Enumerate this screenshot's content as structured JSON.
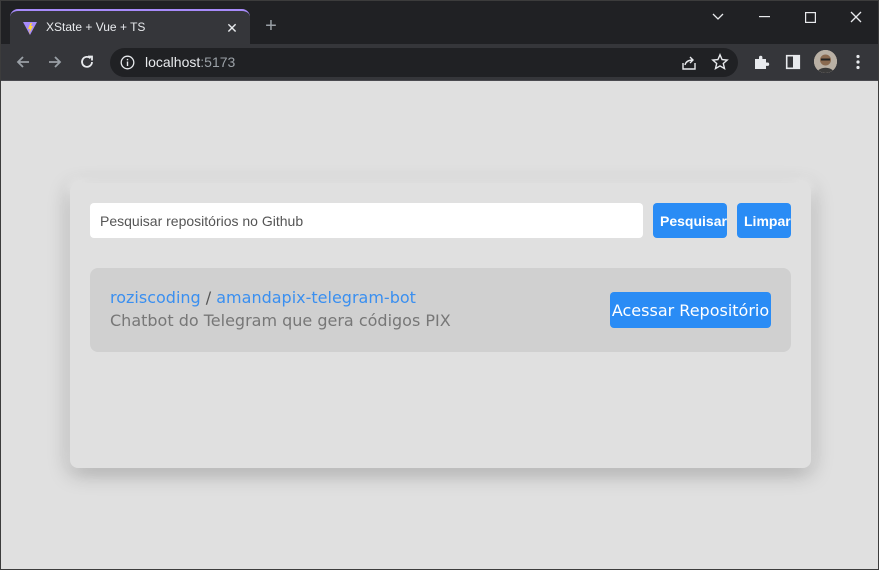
{
  "browser": {
    "tab": {
      "title": "XState + Vue + TS",
      "close_glyph": "✕"
    },
    "new_tab_glyph": "+",
    "address": {
      "host": "localhost",
      "port": ":5173"
    }
  },
  "app": {
    "search": {
      "placeholder": "Pesquisar repositórios no Github",
      "value": ""
    },
    "buttons": {
      "search_label": "Pesquisar",
      "clear_label": "Limpar"
    },
    "results": [
      {
        "owner": "roziscoding",
        "separator": " / ",
        "name": "amandapix-telegram-bot",
        "description": "Chatbot do Telegram que gera códigos PIX",
        "action_label": "Acessar Repositório"
      }
    ]
  },
  "colors": {
    "accent": "#2a8cf5",
    "link": "#3a8ff0",
    "tab_accent": "#a78bfa",
    "page_bg": "#e0e0e0"
  },
  "icons": [
    "vite-favicon-icon",
    "close-icon",
    "plus-icon",
    "chevron-down-icon",
    "minimize-icon",
    "maximize-icon",
    "window-close-icon",
    "back-arrow-icon",
    "forward-arrow-icon",
    "reload-icon",
    "info-icon",
    "share-icon",
    "star-icon",
    "puzzle-icon",
    "sidebar-icon",
    "avatar",
    "kebab-menu-icon"
  ]
}
